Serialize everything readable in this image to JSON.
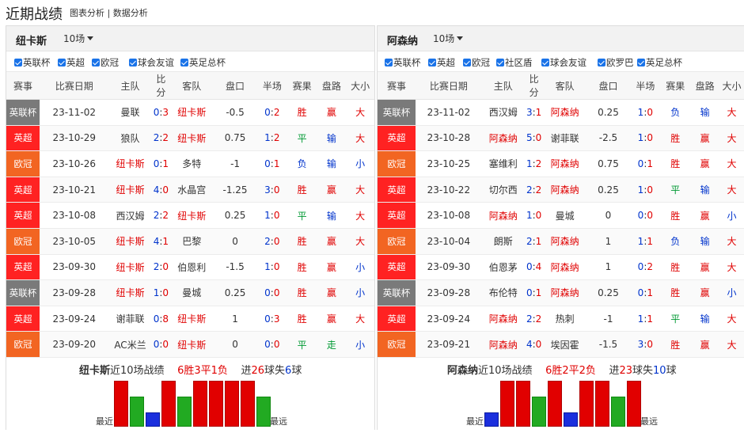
{
  "header": {
    "title": "近期战绩",
    "links": "图表分析 | 数据分析"
  },
  "columns": [
    "赛事",
    "比赛日期",
    "主队",
    "比分",
    "客队",
    "盘口",
    "半场",
    "赛果",
    "盘路",
    "大小"
  ],
  "colors": {
    "英联杯": "#7a7a7a",
    "英超": "#ff2222",
    "欧冠": "#f26522"
  },
  "left": {
    "team": "纽卡斯",
    "count": "10场",
    "filters": [
      "英联杯",
      "英超",
      "欧冠",
      "球会友谊",
      "英足总杯"
    ],
    "rows": [
      {
        "comp": "英联杯",
        "date": "23-11-02",
        "home": "曼联",
        "score": "0:3",
        "away": "纽卡斯",
        "line": "-0.5",
        "half": "0:2",
        "result": "胜",
        "handicap": "赢",
        "ou": "大"
      },
      {
        "comp": "英超",
        "date": "23-10-29",
        "home": "狼队",
        "score": "2:2",
        "away": "纽卡斯",
        "line": "0.75",
        "half": "1:2",
        "result": "平",
        "handicap": "输",
        "ou": "大"
      },
      {
        "comp": "欧冠",
        "date": "23-10-26",
        "home": "纽卡斯",
        "score": "0:1",
        "away": "多特",
        "line": "-1",
        "half": "0:1",
        "result": "负",
        "handicap": "输",
        "ou": "小"
      },
      {
        "comp": "英超",
        "date": "23-10-21",
        "home": "纽卡斯",
        "score": "4:0",
        "away": "水晶宫",
        "line": "-1.25",
        "half": "3:0",
        "result": "胜",
        "handicap": "赢",
        "ou": "大"
      },
      {
        "comp": "英超",
        "date": "23-10-08",
        "home": "西汉姆",
        "score": "2:2",
        "away": "纽卡斯",
        "line": "0.25",
        "half": "1:0",
        "result": "平",
        "handicap": "输",
        "ou": "大"
      },
      {
        "comp": "欧冠",
        "date": "23-10-05",
        "home": "纽卡斯",
        "score": "4:1",
        "away": "巴黎",
        "line": "0",
        "half": "2:0",
        "result": "胜",
        "handicap": "赢",
        "ou": "大"
      },
      {
        "comp": "英超",
        "date": "23-09-30",
        "home": "纽卡斯",
        "score": "2:0",
        "away": "伯恩利",
        "line": "-1.5",
        "half": "1:0",
        "result": "胜",
        "handicap": "赢",
        "ou": "小"
      },
      {
        "comp": "英联杯",
        "date": "23-09-28",
        "home": "纽卡斯",
        "score": "1:0",
        "away": "曼城",
        "line": "0.25",
        "half": "0:0",
        "result": "胜",
        "handicap": "赢",
        "ou": "小"
      },
      {
        "comp": "英超",
        "date": "23-09-24",
        "home": "谢菲联",
        "score": "0:8",
        "away": "纽卡斯",
        "line": "1",
        "half": "0:3",
        "result": "胜",
        "handicap": "赢",
        "ou": "大"
      },
      {
        "comp": "欧冠",
        "date": "23-09-20",
        "home": "AC米兰",
        "score": "0:0",
        "away": "纽卡斯",
        "line": "0",
        "half": "0:0",
        "result": "平",
        "handicap": "走",
        "ou": "小"
      }
    ],
    "summary": {
      "team": "纽卡斯",
      "text": "近10场战绩",
      "wdl": "6胜3平1负",
      "goals_prefix": "进",
      "goals_for": "26",
      "goals_mid": "球失",
      "goals_against": "6",
      "goals_suffix": "球",
      "recent": "最近",
      "oldest": "最远"
    },
    "bars": [
      "w",
      "d",
      "l",
      "w",
      "d",
      "w",
      "w",
      "w",
      "w",
      "d"
    ]
  },
  "right": {
    "team": "阿森纳",
    "count": "10场",
    "filters": [
      "英联杯",
      "英超",
      "欧冠",
      "社区盾",
      "球会友谊",
      "欧罗巴",
      "英足总杯"
    ],
    "rows": [
      {
        "comp": "英联杯",
        "date": "23-11-02",
        "home": "西汉姆",
        "score": "3:1",
        "away": "阿森纳",
        "line": "0.25",
        "half": "1:0",
        "result": "负",
        "handicap": "输",
        "ou": "大"
      },
      {
        "comp": "英超",
        "date": "23-10-28",
        "home": "阿森纳",
        "score": "5:0",
        "away": "谢菲联",
        "line": "-2.5",
        "half": "1:0",
        "result": "胜",
        "handicap": "赢",
        "ou": "大"
      },
      {
        "comp": "欧冠",
        "date": "23-10-25",
        "home": "塞维利",
        "score": "1:2",
        "away": "阿森纳",
        "line": "0.75",
        "half": "0:1",
        "result": "胜",
        "handicap": "赢",
        "ou": "大"
      },
      {
        "comp": "英超",
        "date": "23-10-22",
        "home": "切尔西",
        "score": "2:2",
        "away": "阿森纳",
        "line": "0.25",
        "half": "1:0",
        "result": "平",
        "handicap": "输",
        "ou": "大"
      },
      {
        "comp": "英超",
        "date": "23-10-08",
        "home": "阿森纳",
        "score": "1:0",
        "away": "曼城",
        "line": "0",
        "half": "0:0",
        "result": "胜",
        "handicap": "赢",
        "ou": "小"
      },
      {
        "comp": "欧冠",
        "date": "23-10-04",
        "home": "朗斯",
        "score": "2:1",
        "away": "阿森纳",
        "line": "1",
        "half": "1:1",
        "result": "负",
        "handicap": "输",
        "ou": "大"
      },
      {
        "comp": "英超",
        "date": "23-09-30",
        "home": "伯恩茅",
        "score": "0:4",
        "away": "阿森纳",
        "line": "1",
        "half": "0:2",
        "result": "胜",
        "handicap": "赢",
        "ou": "大"
      },
      {
        "comp": "英联杯",
        "date": "23-09-28",
        "home": "布伦特",
        "score": "0:1",
        "away": "阿森纳",
        "line": "0.25",
        "half": "0:1",
        "result": "胜",
        "handicap": "赢",
        "ou": "小"
      },
      {
        "comp": "英超",
        "date": "23-09-24",
        "home": "阿森纳",
        "score": "2:2",
        "away": "热刺",
        "line": "-1",
        "half": "1:1",
        "result": "平",
        "handicap": "输",
        "ou": "大"
      },
      {
        "comp": "欧冠",
        "date": "23-09-21",
        "home": "阿森纳",
        "score": "4:0",
        "away": "埃因霍",
        "line": "-1.5",
        "half": "3:0",
        "result": "胜",
        "handicap": "赢",
        "ou": "大"
      }
    ],
    "summary": {
      "team": "阿森纳",
      "text": "近10场战绩",
      "wdl": "6胜2平2负",
      "goals_prefix": "进",
      "goals_for": "23",
      "goals_mid": "球失",
      "goals_against": "10",
      "goals_suffix": "球",
      "recent": "最近",
      "oldest": "最远"
    },
    "bars": [
      "l",
      "w",
      "w",
      "d",
      "w",
      "l",
      "w",
      "w",
      "d",
      "w"
    ]
  }
}
